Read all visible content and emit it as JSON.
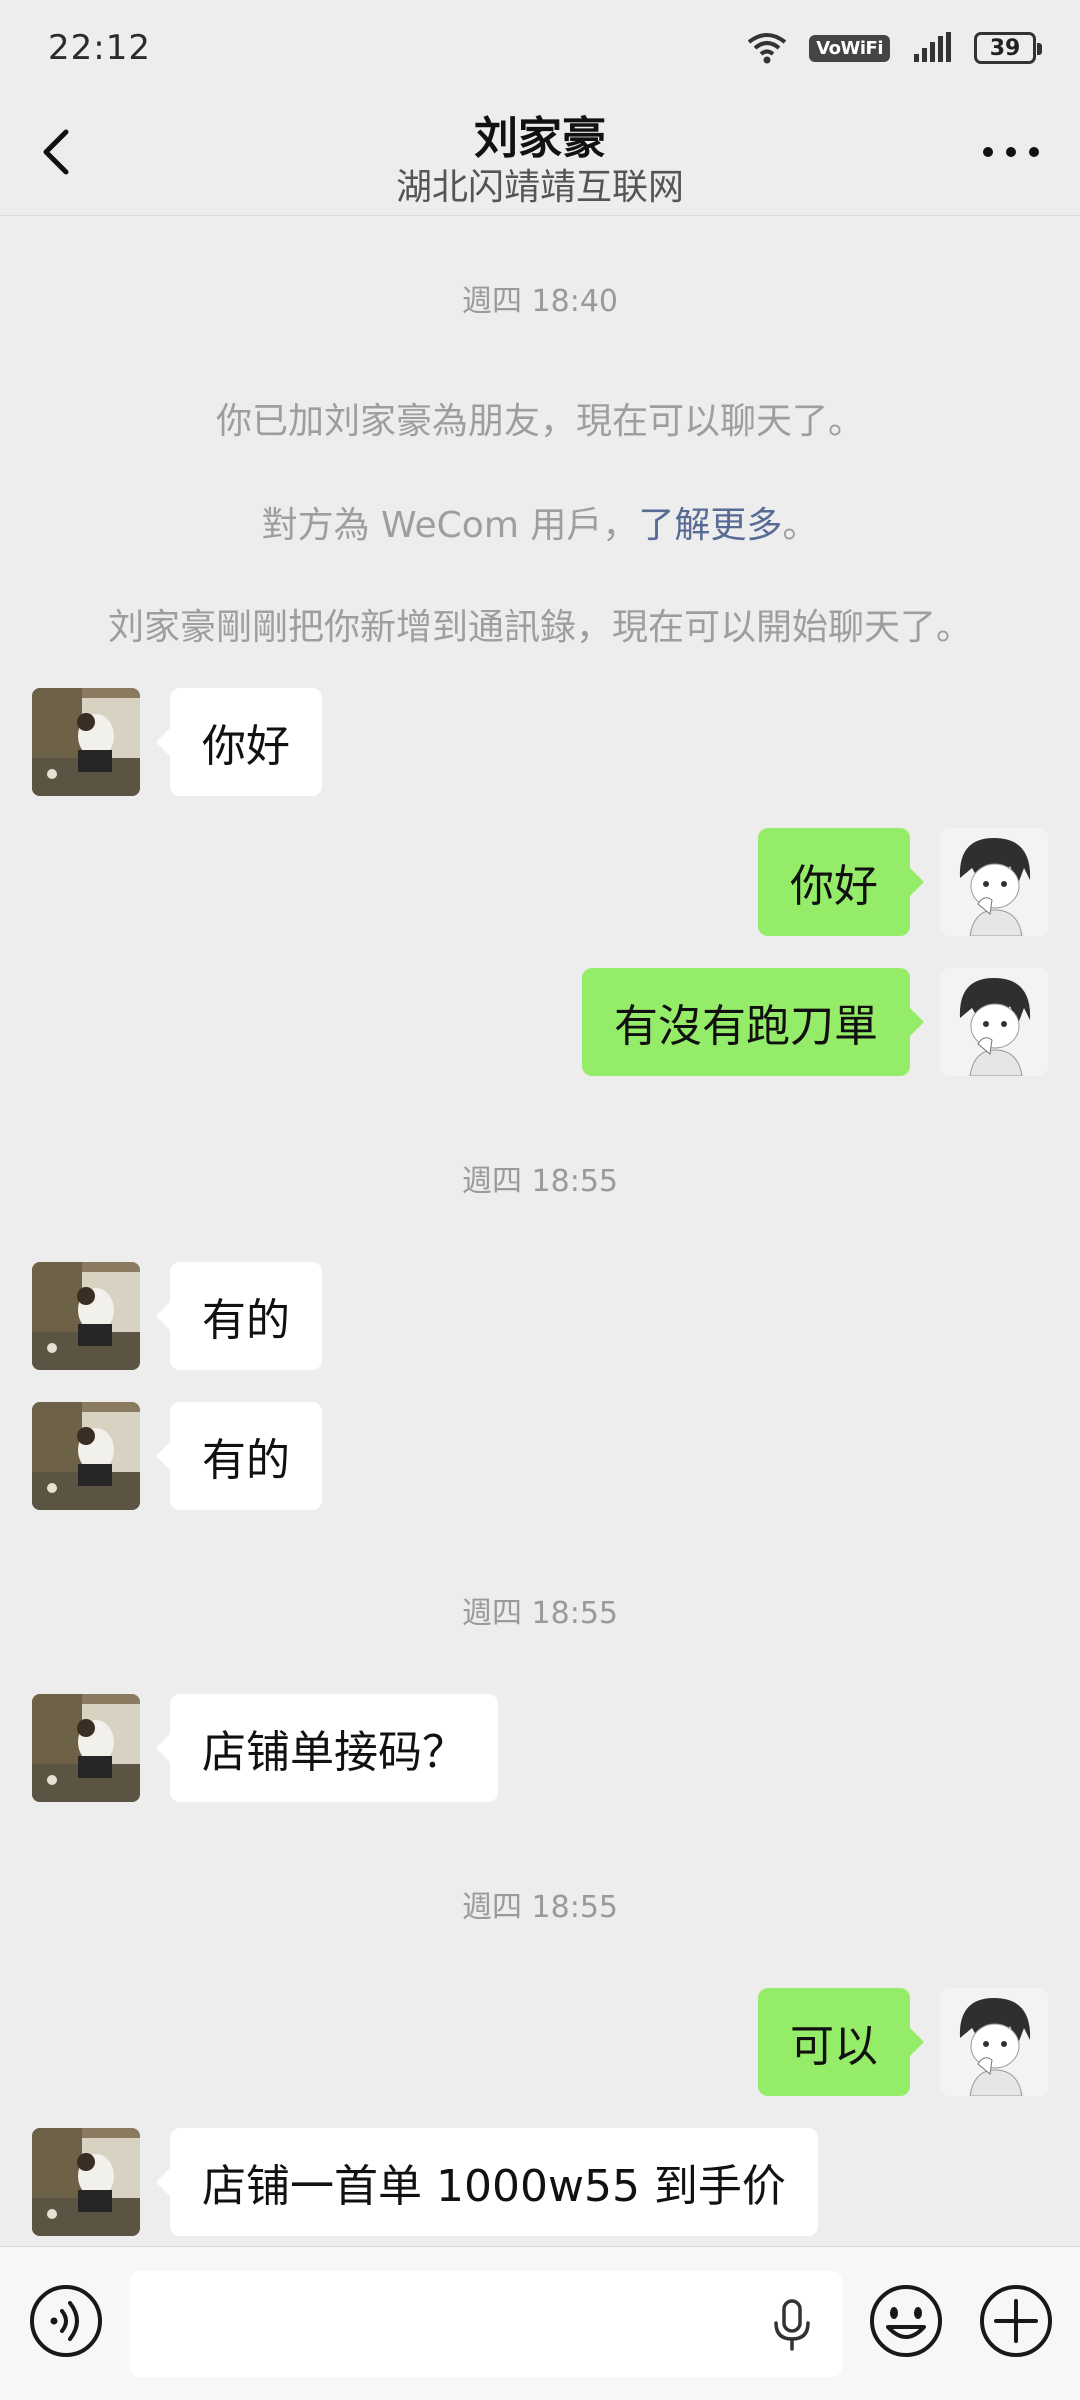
{
  "status_bar": {
    "time": "22:12",
    "network_badge": "VoWiFi",
    "battery": "39"
  },
  "header": {
    "title": "刘家豪",
    "subtitle": "湖北闪靖靖互联网"
  },
  "chat": {
    "time_1": "週四 18:40",
    "system_1": "你已加刘家豪為朋友，現在可以聊天了。",
    "system_2_prefix": "對方為 WeCom 用戶，",
    "system_2_link": "了解更多",
    "system_2_suffix": "。",
    "system_3": "刘家豪剛剛把你新增到通訊錄，現在可以開始聊天了。",
    "msg_1": "你好",
    "msg_2": "你好",
    "msg_3": "有沒有跑刀單",
    "time_2": "週四 18:55",
    "msg_4": "有的",
    "msg_5": "有的",
    "time_3": "週四 18:55",
    "msg_6": "店铺单接码？",
    "time_4": "週四 18:55",
    "msg_7": "可以",
    "msg_8": "店铺一首单 1000w55 到手价"
  },
  "icons": {
    "back": "chevron-left-icon",
    "more": "more-dots-icon",
    "voice": "voice-icon",
    "mic": "microphone-icon",
    "emoji": "emoji-icon",
    "plus": "plus-icon"
  },
  "colors": {
    "self_bubble": "#95ec69",
    "other_bubble": "#ffffff",
    "link": "#576b95"
  }
}
